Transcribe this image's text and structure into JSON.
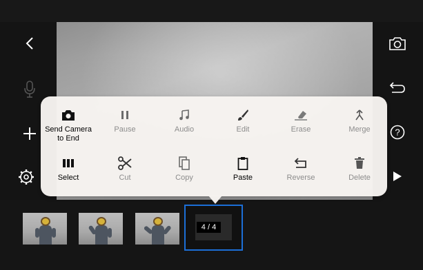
{
  "menu": {
    "row1": [
      {
        "label": "Send Camera to End",
        "icon": "camera-icon",
        "enabled": true
      },
      {
        "label": "Pause",
        "icon": "pause-icon",
        "enabled": false
      },
      {
        "label": "Audio",
        "icon": "music-note-icon",
        "enabled": false
      },
      {
        "label": "Edit",
        "icon": "brush-icon",
        "enabled": false
      },
      {
        "label": "Erase",
        "icon": "eraser-icon",
        "enabled": false
      },
      {
        "label": "Merge",
        "icon": "merge-icon",
        "enabled": false
      }
    ],
    "row2": [
      {
        "label": "Select",
        "icon": "select-columns-icon",
        "enabled": true
      },
      {
        "label": "Cut",
        "icon": "scissors-icon",
        "enabled": false
      },
      {
        "label": "Copy",
        "icon": "copy-icon",
        "enabled": false
      },
      {
        "label": "Paste",
        "icon": "clipboard-icon",
        "enabled": true
      },
      {
        "label": "Reverse",
        "icon": "reverse-icon",
        "enabled": false
      },
      {
        "label": "Delete",
        "icon": "trash-icon",
        "enabled": false
      }
    ]
  },
  "timeline": {
    "frame_counter": "4 / 4",
    "frames": [
      {
        "name": "frame-1"
      },
      {
        "name": "frame-2"
      },
      {
        "name": "frame-3"
      }
    ]
  },
  "toolbar": {
    "left": [
      "back-chevron-icon",
      "microphone-icon",
      "plus-icon",
      "settings-gear-icon"
    ],
    "right": [
      "camera-switch-icon",
      "undo-icon",
      "help-icon",
      "play-icon"
    ]
  },
  "colors": {
    "selection_border": "#1c6fd8",
    "popup_bg": "#f7f4f1",
    "toolbar_icon": "#ffffff",
    "disabled_label": "#8c8c8c"
  }
}
